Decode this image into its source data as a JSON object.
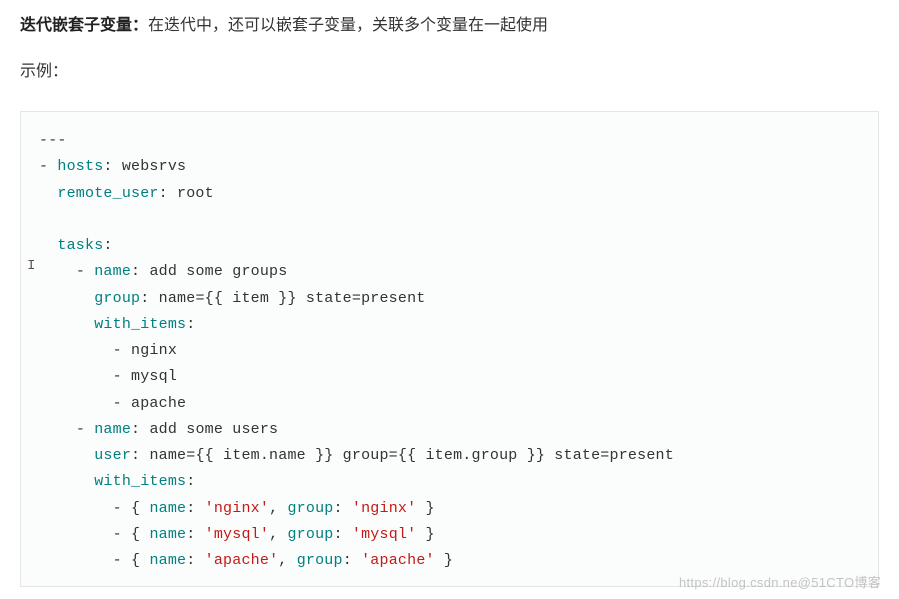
{
  "heading": {
    "bold": "迭代嵌套子变量：",
    "rest": "在迭代中，还可以嵌套子变量，关联多个变量在一起使用"
  },
  "example_label": "示例：",
  "code": {
    "doc_start": "---",
    "hosts_key": "hosts",
    "hosts_val": "websrvs",
    "remote_user_key": "remote_user",
    "remote_user_val": "root",
    "tasks_key": "tasks",
    "t1_name_key": "name",
    "t1_name_val": "add some groups",
    "t1_group_key": "group",
    "t1_group_val": "name={{ item }} state=present",
    "t1_with_key": "with_items",
    "t1_item1": "nginx",
    "t1_item2": "mysql",
    "t1_item3": "apache",
    "t2_name_key": "name",
    "t2_name_val": "add some users",
    "t2_user_key": "user",
    "t2_user_val": "name={{ item.name }} group={{ item.group }} state=present",
    "t2_with_key": "with_items",
    "d1_name_k": "name",
    "d1_name_v": "'nginx'",
    "d1_group_k": "group",
    "d1_group_v": "'nginx'",
    "d2_name_k": "name",
    "d2_name_v": "'mysql'",
    "d2_group_k": "group",
    "d2_group_v": "'mysql'",
    "d3_name_k": "name",
    "d3_name_v": "'apache'",
    "d3_group_k": "group",
    "d3_group_v": "'apache'"
  },
  "watermark_left": "https://blog.csdn.ne",
  "watermark_right": "@51CTO博客",
  "cursor": "I"
}
